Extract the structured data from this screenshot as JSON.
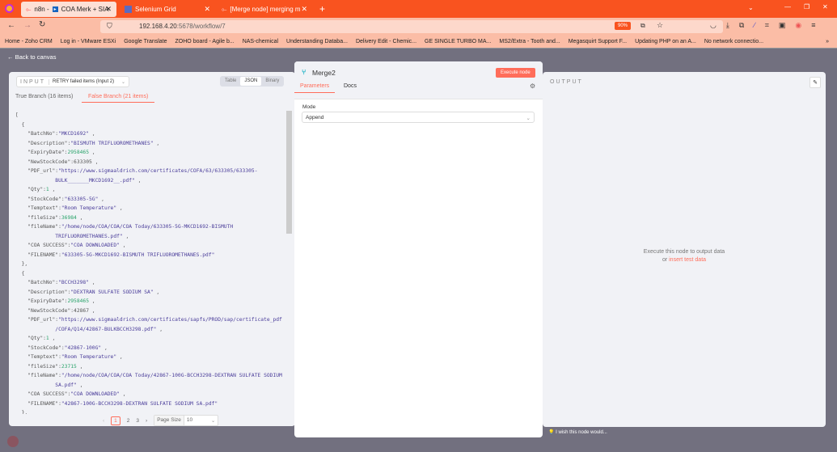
{
  "browser": {
    "tabs": [
      {
        "label": "n8n - ",
        "label2": "COA Merk + SIA"
      },
      {
        "label": "Selenium Grid"
      },
      {
        "label": "[Merge node] merging multiple"
      }
    ],
    "url_host": "192.168.4.20",
    "url_path": ":5678/workflow/7",
    "zoom": "90%",
    "bookmarks": [
      "Home - Zoho CRM",
      "Log in - VMware ESXi",
      "Google Translate",
      "ZOHO board - Agile b...",
      "NAS-chemical",
      "Understanding Databa...",
      "Delivery Edit - Chemic...",
      "GE SINGLE TURBO MA...",
      "MS2/Extra - Tooth and...",
      "Megasquirt Support F...",
      "Updating PHP on an A...",
      "No network connectio..."
    ]
  },
  "back_label": "Back to canvas",
  "input": {
    "label": "INPUT",
    "selector": "RETRY failed items (Input 2)",
    "views": [
      "Table",
      "JSON",
      "Binary"
    ],
    "active_view": "JSON",
    "branches": [
      "True Branch (16 items)",
      "False Branch (21 items)"
    ],
    "items": [
      {
        "BatchNo": "\"MKCD1692\"",
        "Description": "\"BISMUTH TRIFLUOROMETHANES\"",
        "ExpiryDate": "2958465",
        "NewStockCode": "633305",
        "PDF_url_1": "\"https://www.sigmaaldrich.com/certificates/COFA/63/633305/633305-",
        "PDF_url_2": "BULK_______MKCD1692__.pdf\"",
        "Qty": "1",
        "StockCode": "\"633305-5G\"",
        "Temptext": "\"Room Temperature\"",
        "fileSize": "36984",
        "fileName_1": "\"/home/node/COA/COA/COA Today/633305-5G-MKCD1692-BISMUTH",
        "fileName_2": "TRIFLUOROMETHANES.pdf\"",
        "COA_SUCCESS": "\"COA DOWNLOADED\"",
        "FILENAME": "\"633305-5G-MKCD1692-BISMUTH TRIFLUOROMETHANES.pdf\""
      },
      {
        "BatchNo": "\"BCCH3298\"",
        "Description": "\"DEXTRAN SULFATE SODIUM SA\"",
        "ExpiryDate": "2958465",
        "NewStockCode": "42867",
        "PDF_url_1": "\"https://www.sigmaaldrich.com/certificates/sapfs/PROD/sap/certificate_pdfs",
        "PDF_url_2": "/COFA/Q14/42867-BULKBCCH3298.pdf\"",
        "Qty": "1",
        "StockCode": "\"42867-100G\"",
        "Temptext": "\"Room Temperature\"",
        "fileSize": "23715",
        "fileName_1": "\"/home/node/COA/COA/COA Today/42867-100G-BCCH3298-DEXTRAN SULFATE SODIUM",
        "fileName_2": "SA.pdf\"",
        "COA_SUCCESS": "\"COA DOWNLOADED\"",
        "FILENAME": "\"42867-100G-BCCH3298-DEXTRAN SULFATE SODIUM SA.pdf\""
      }
    ],
    "keys": {
      "BatchNo": "\"BatchNo\":",
      "Description": "\"Description\":",
      "ExpiryDate": "\"ExpiryDate\":",
      "NewStockCode": "\"NewStockCode\":",
      "PDF_url": "\"PDF_url\":",
      "Qty": "\"Qty\":",
      "StockCode": "\"StockCode\":",
      "Temptext": "\"Temptext\":",
      "fileSize": "\"fileSize\":",
      "fileName": "\"fileName\":",
      "COA_SUCCESS": "\"COA SUCCESS\":",
      "FILENAME": "\"FILENAME\":"
    },
    "pages": [
      "1",
      "2",
      "3"
    ],
    "page_size_label": "Page Size",
    "page_size": "10"
  },
  "node": {
    "title": "Merge2",
    "execute": "Execute node",
    "tabs": [
      "Parameters",
      "Docs"
    ],
    "mode_label": "Mode",
    "mode_value": "Append"
  },
  "output": {
    "label": "OUTPUT",
    "empty_text": "Execute this node to output data",
    "or": "or ",
    "insert_link": "insert test data"
  },
  "feedback": "I wish this node would..."
}
